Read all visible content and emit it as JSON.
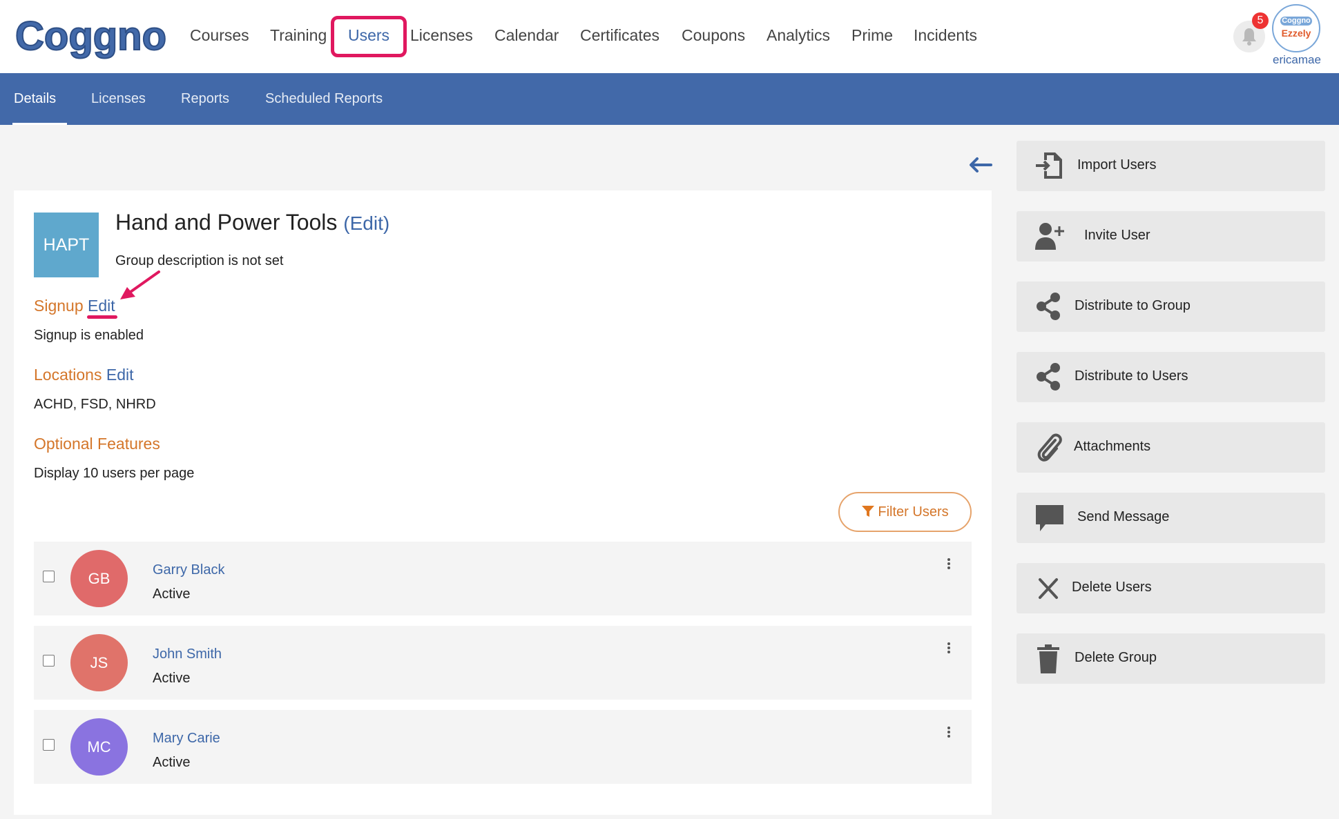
{
  "brand": {
    "name": "Coggno"
  },
  "nav": {
    "items": [
      "Courses",
      "Training",
      "Users",
      "Licenses",
      "Calendar",
      "Certificates",
      "Coupons",
      "Analytics",
      "Prime",
      "Incidents"
    ],
    "active": "Users"
  },
  "header": {
    "notifications_count": "5",
    "org_logo_top": "Coggno",
    "org_logo_bottom": "Ezzely",
    "username": "ericamae"
  },
  "subnav": {
    "items": [
      "Details",
      "Licenses",
      "Reports",
      "Scheduled Reports"
    ],
    "active": "Details"
  },
  "group": {
    "initials": "HAPT",
    "name": "Hand and Power Tools",
    "edit_label": "(Edit)",
    "description": "Group description is not set"
  },
  "sections": {
    "signup": {
      "title": "Signup",
      "edit": "Edit",
      "text": "Signup is enabled"
    },
    "locations": {
      "title": "Locations",
      "edit": "Edit",
      "text": "ACHD, FSD, NHRD"
    },
    "optional": {
      "title": "Optional Features",
      "text": "Display 10 users per page"
    }
  },
  "filter": {
    "label": "Filter Users"
  },
  "users": [
    {
      "initials": "GB",
      "name": "Garry Black",
      "status": "Active",
      "color": "#e06a6a"
    },
    {
      "initials": "JS",
      "name": "John Smith",
      "status": "Active",
      "color": "#e0736a"
    },
    {
      "initials": "MC",
      "name": "Mary Carie",
      "status": "Active",
      "color": "#8a73e0"
    }
  ],
  "actions": [
    {
      "label": "Import Users",
      "icon": "import-icon"
    },
    {
      "label": "Invite User",
      "icon": "add-user-icon"
    },
    {
      "label": "Distribute to Group",
      "icon": "share-icon"
    },
    {
      "label": "Distribute to Users",
      "icon": "share-icon"
    },
    {
      "label": "Attachments",
      "icon": "paperclip-icon"
    },
    {
      "label": "Send Message",
      "icon": "message-icon"
    },
    {
      "label": "Delete Users",
      "icon": "close-icon"
    },
    {
      "label": "Delete Group",
      "icon": "trash-icon"
    }
  ],
  "colors": {
    "primary": "#4269a9",
    "link": "#3d67a8",
    "section": "#d4762a",
    "highlight": "#e0185f"
  }
}
